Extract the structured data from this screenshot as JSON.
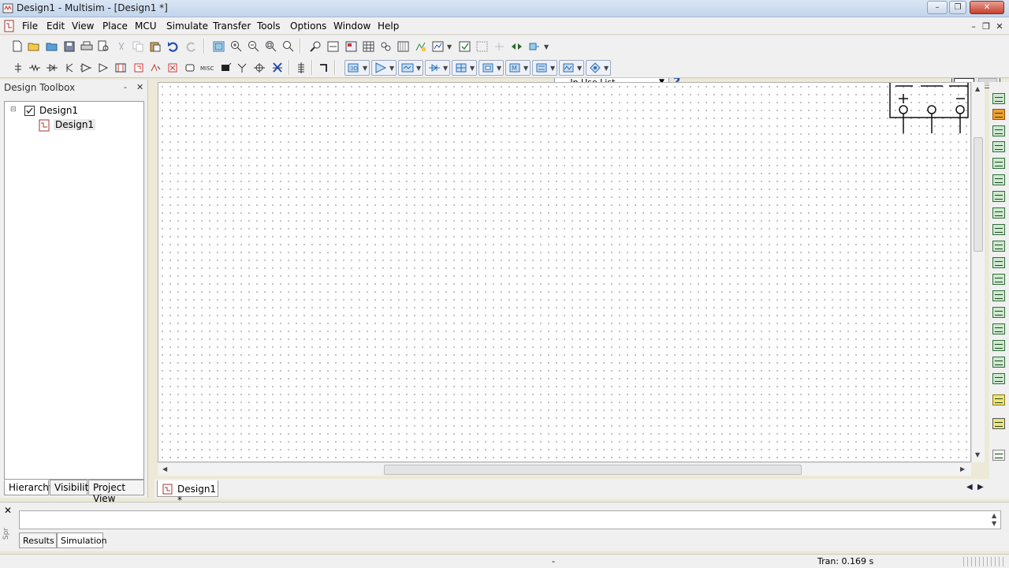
{
  "window": {
    "title": "Design1 - Multisim - [Design1 *]",
    "minimize": "–",
    "restore": "❐",
    "close": "✕"
  },
  "menu": {
    "items": [
      "File",
      "Edit",
      "View",
      "Place",
      "MCU",
      "Simulate",
      "Transfer",
      "Tools",
      "Options",
      "Window",
      "Help"
    ],
    "mdi": {
      "minimize": "–",
      "restore": "❐",
      "close": "✕"
    }
  },
  "toolbar": {
    "in_use_list": "--- In Use List ---",
    "help": "?"
  },
  "design_toolbox": {
    "title": "Design Toolbox",
    "pin": "‐",
    "close": "✕",
    "tree": {
      "root": "Design1",
      "child": "Design1"
    },
    "tabs": [
      "Hierarchy",
      "Visibility",
      "Project View"
    ]
  },
  "document_tabs": [
    {
      "label": "Design1 *"
    }
  ],
  "spreadsheet": {
    "close": "✕",
    "side_label": "Spr",
    "tabs": [
      "Results",
      "Simulation"
    ]
  },
  "status": {
    "center": "-",
    "transient": "Tran: 0.169 s"
  },
  "colors": {
    "accent": "#1f4fb8",
    "canvas_bg": "#ffffff",
    "grid_dot": "#8a8a8a",
    "instrument_green": "#2f6f3a"
  }
}
